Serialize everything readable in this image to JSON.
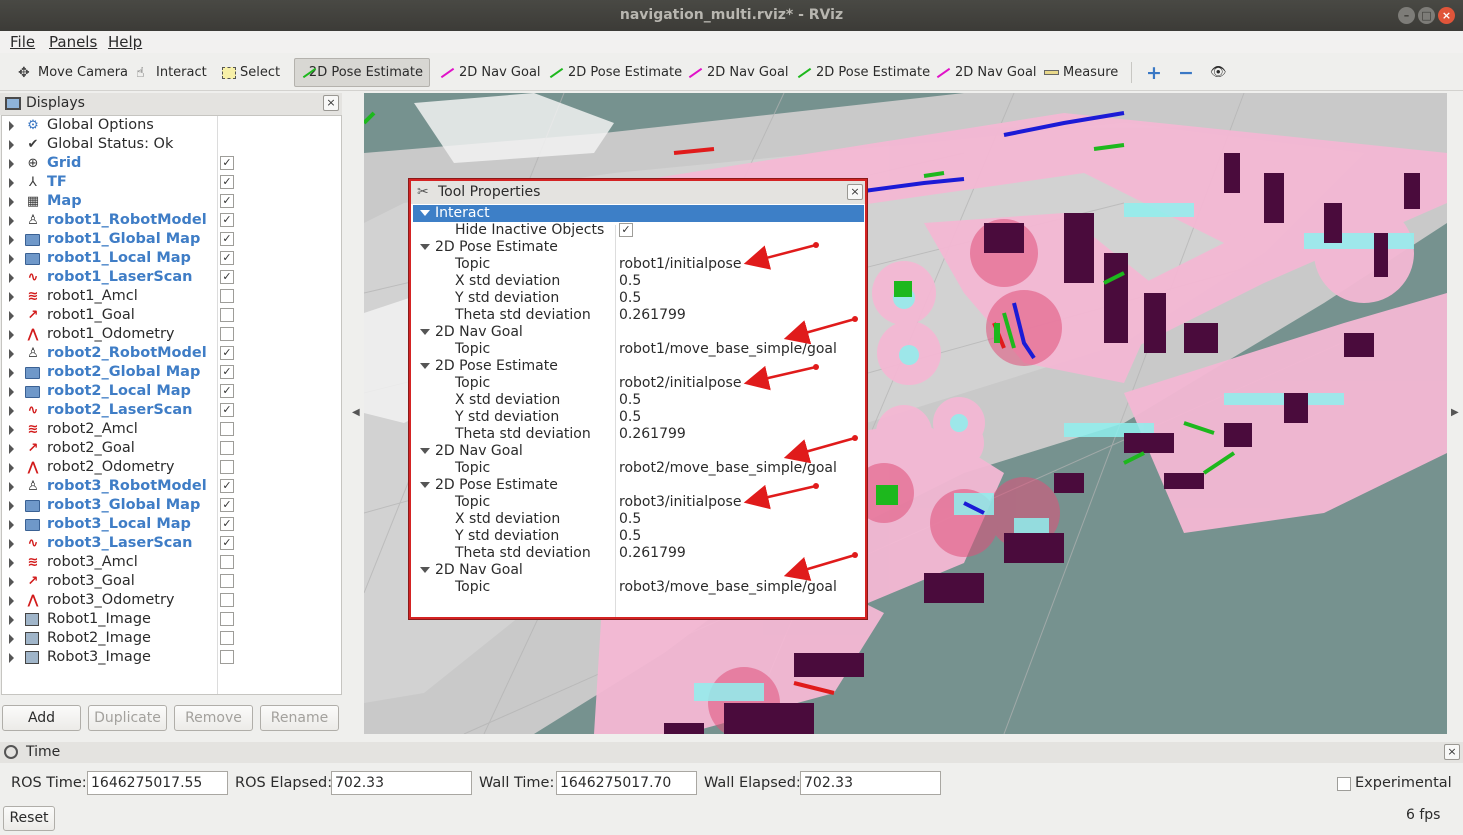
{
  "window": {
    "title": "navigation_multi.rviz* - RViz",
    "minimize": "–",
    "maximize": "□",
    "close": "×"
  },
  "menu": {
    "file": "File",
    "panels": "Panels",
    "help": "Help"
  },
  "toolbar": {
    "tools": [
      {
        "label": "Move Camera",
        "icon": "move-camera-icon"
      },
      {
        "label": "Interact",
        "icon": "hand-icon"
      },
      {
        "label": "Select",
        "icon": "select-box-icon"
      },
      {
        "label": "2D Pose Estimate",
        "icon": "green-arrow-icon",
        "active": true
      },
      {
        "label": "2D Nav Goal",
        "icon": "magenta-arrow-icon"
      },
      {
        "label": "2D Pose Estimate",
        "icon": "green-arrow-icon"
      },
      {
        "label": "2D Nav Goal",
        "icon": "magenta-arrow-icon"
      },
      {
        "label": "2D Pose Estimate",
        "icon": "green-arrow-icon"
      },
      {
        "label": "2D Nav Goal",
        "icon": "magenta-arrow-icon"
      },
      {
        "label": "Measure",
        "icon": "ruler-icon"
      }
    ],
    "plus": "+",
    "minus": "−",
    "eye": "👁"
  },
  "displays": {
    "title": "Displays",
    "close": "×",
    "items": [
      {
        "label": "Global Options",
        "icon": "gear-icon",
        "checked": null,
        "enabled": false
      },
      {
        "label": "Global Status: Ok",
        "icon": "checkmark-icon",
        "checked": null,
        "enabled": false
      },
      {
        "label": "Grid",
        "icon": "grid-icon",
        "checked": true,
        "enabled": true
      },
      {
        "label": "TF",
        "icon": "tf-icon",
        "checked": true,
        "enabled": true
      },
      {
        "label": "Map",
        "icon": "map-icon",
        "checked": true,
        "enabled": true
      },
      {
        "label": "robot1_RobotModel",
        "icon": "robot-model-icon",
        "checked": true,
        "enabled": true
      },
      {
        "label": "robot1_Global Map",
        "icon": "folder-icon",
        "checked": true,
        "enabled": true
      },
      {
        "label": "robot1_Local Map",
        "icon": "folder-icon",
        "checked": true,
        "enabled": true
      },
      {
        "label": "robot1_LaserScan",
        "icon": "laserscan-icon",
        "checked": true,
        "enabled": true
      },
      {
        "label": "robot1_Amcl",
        "icon": "amcl-icon",
        "checked": false,
        "enabled": false
      },
      {
        "label": "robot1_Goal",
        "icon": "pose-icon",
        "checked": false,
        "enabled": false
      },
      {
        "label": "robot1_Odometry",
        "icon": "odometry-icon",
        "checked": false,
        "enabled": false
      },
      {
        "label": "robot2_RobotModel",
        "icon": "robot-model-icon",
        "checked": true,
        "enabled": true
      },
      {
        "label": "robot2_Global Map",
        "icon": "folder-icon",
        "checked": true,
        "enabled": true
      },
      {
        "label": "robot2_Local Map",
        "icon": "folder-icon",
        "checked": true,
        "enabled": true
      },
      {
        "label": "robot2_LaserScan",
        "icon": "laserscan-icon",
        "checked": true,
        "enabled": true
      },
      {
        "label": "robot2_Amcl",
        "icon": "amcl-icon",
        "checked": false,
        "enabled": false
      },
      {
        "label": "robot2_Goal",
        "icon": "pose-icon",
        "checked": false,
        "enabled": false
      },
      {
        "label": "robot2_Odometry",
        "icon": "odometry-icon",
        "checked": false,
        "enabled": false
      },
      {
        "label": "robot3_RobotModel",
        "icon": "robot-model-icon",
        "checked": true,
        "enabled": true
      },
      {
        "label": "robot3_Global Map",
        "icon": "folder-icon",
        "checked": true,
        "enabled": true
      },
      {
        "label": "robot3_Local Map",
        "icon": "folder-icon",
        "checked": true,
        "enabled": true
      },
      {
        "label": "robot3_LaserScan",
        "icon": "laserscan-icon",
        "checked": true,
        "enabled": true
      },
      {
        "label": "robot3_Amcl",
        "icon": "amcl-icon",
        "checked": false,
        "enabled": false
      },
      {
        "label": "robot3_Goal",
        "icon": "pose-icon",
        "checked": false,
        "enabled": false
      },
      {
        "label": "robot3_Odometry",
        "icon": "odometry-icon",
        "checked": false,
        "enabled": false
      },
      {
        "label": "Robot1_Image",
        "icon": "image-icon",
        "checked": false,
        "enabled": false
      },
      {
        "label": "Robot2_Image",
        "icon": "image-icon",
        "checked": false,
        "enabled": false
      },
      {
        "label": "Robot3_Image",
        "icon": "image-icon",
        "checked": false,
        "enabled": false
      }
    ],
    "buttons": {
      "add": "Add",
      "duplicate": "Duplicate",
      "remove": "Remove",
      "rename": "Rename"
    }
  },
  "tool_properties": {
    "title": "Tool Properties",
    "close": "×",
    "rows": [
      {
        "name": "Interact",
        "value": "",
        "level": 0,
        "selected": true,
        "expand": true
      },
      {
        "name": "Hide Inactive Objects",
        "value": "",
        "level": 1,
        "checkbox": true
      },
      {
        "name": "2D Pose Estimate",
        "value": "",
        "level": 0,
        "expand": true
      },
      {
        "name": "Topic",
        "value": "robot1/initialpose",
        "level": 1
      },
      {
        "name": "X std deviation",
        "value": "0.5",
        "level": 1
      },
      {
        "name": "Y std deviation",
        "value": "0.5",
        "level": 1
      },
      {
        "name": "Theta std deviation",
        "value": "0.261799",
        "level": 1
      },
      {
        "name": "2D Nav Goal",
        "value": "",
        "level": 0,
        "expand": true
      },
      {
        "name": "Topic",
        "value": "robot1/move_base_simple/goal",
        "level": 1
      },
      {
        "name": "2D Pose Estimate",
        "value": "",
        "level": 0,
        "expand": true
      },
      {
        "name": "Topic",
        "value": "robot2/initialpose",
        "level": 1
      },
      {
        "name": "X std deviation",
        "value": "0.5",
        "level": 1
      },
      {
        "name": "Y std deviation",
        "value": "0.5",
        "level": 1
      },
      {
        "name": "Theta std deviation",
        "value": "0.261799",
        "level": 1
      },
      {
        "name": "2D Nav Goal",
        "value": "",
        "level": 0,
        "expand": true
      },
      {
        "name": "Topic",
        "value": "robot2/move_base_simple/goal",
        "level": 1
      },
      {
        "name": "2D Pose Estimate",
        "value": "",
        "level": 0,
        "expand": true
      },
      {
        "name": "Topic",
        "value": "robot3/initialpose",
        "level": 1
      },
      {
        "name": "X std deviation",
        "value": "0.5",
        "level": 1
      },
      {
        "name": "Y std deviation",
        "value": "0.5",
        "level": 1
      },
      {
        "name": "Theta std deviation",
        "value": "0.261799",
        "level": 1
      },
      {
        "name": "2D Nav Goal",
        "value": "",
        "level": 0,
        "expand": true
      },
      {
        "name": "Topic",
        "value": "robot3/move_base_simple/goal",
        "level": 1
      }
    ]
  },
  "time": {
    "title": "Time",
    "close": "×",
    "ros_time_label": "ROS Time:",
    "ros_time": "1646275017.55",
    "ros_elapsed_label": "ROS Elapsed:",
    "ros_elapsed": "702.33",
    "wall_time_label": "Wall Time:",
    "wall_time": "1646275017.70",
    "wall_elapsed_label": "Wall Elapsed:",
    "wall_elapsed": "702.33",
    "experimental_label": "Experimental",
    "reset": "Reset",
    "fps": "6 fps"
  },
  "colors": {
    "accent": "#3d7fc7",
    "annotation": "#e01b1b",
    "map_free": "#c8c8c8",
    "map_unknown": "#76928f",
    "costmap": "#f5b8d6",
    "obstacle": "#4a0b3c",
    "inflation": "#7fe8e8"
  }
}
